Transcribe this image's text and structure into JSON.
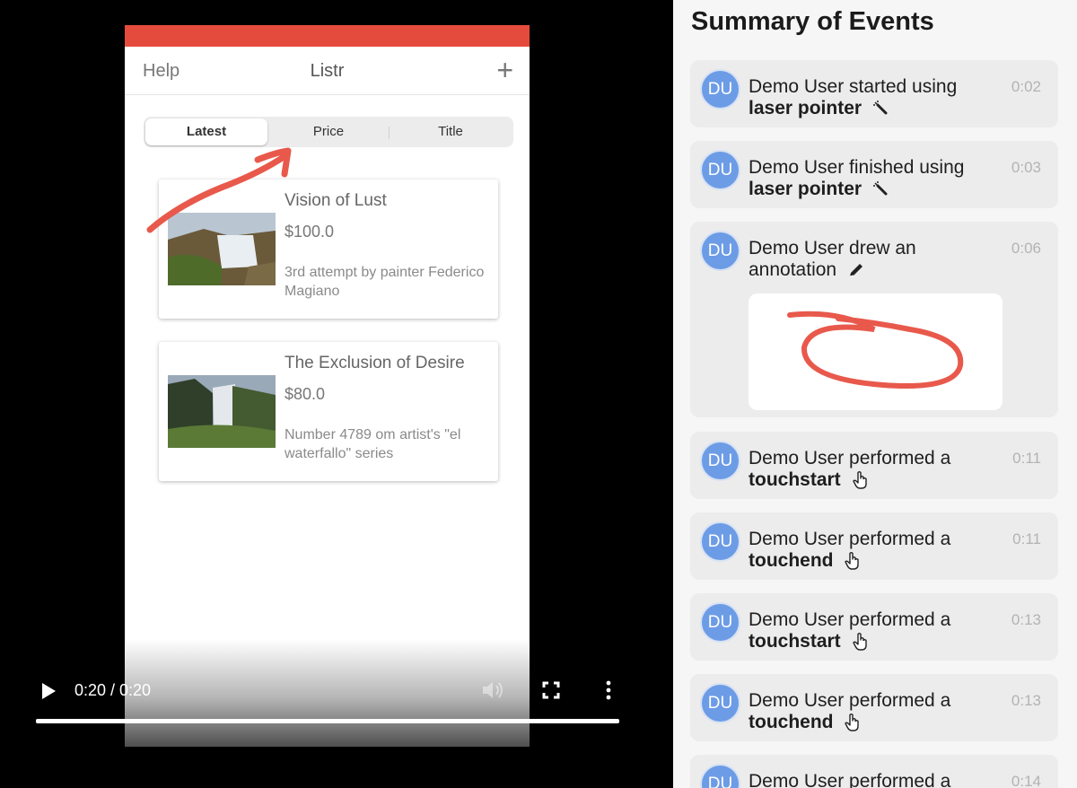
{
  "app": {
    "nav": {
      "left": "Help",
      "title": "Listr",
      "add": "+"
    },
    "tabs": [
      {
        "label": "Latest",
        "active": true
      },
      {
        "label": "Price",
        "active": false
      },
      {
        "label": "Title",
        "active": false
      }
    ],
    "listings": [
      {
        "title": "Vision of Lust",
        "price": "$100.0",
        "description": "3rd attempt by painter Federico Magiano"
      },
      {
        "title": "The Exclusion of Desire",
        "price": "$80.0",
        "description": "Number 4789 om artist's \"el waterfallo\" series"
      }
    ],
    "status_color": "#e54b3c",
    "annotation_color": "#e8594c"
  },
  "player": {
    "time": "0:20 / 0:20",
    "progress": 1.0
  },
  "summary": {
    "title": "Summary of Events",
    "events": [
      {
        "avatar": "DU",
        "text": "Demo User started using",
        "bold": "laser pointer",
        "icon": "laser-pointer-icon",
        "time": "0:02"
      },
      {
        "avatar": "DU",
        "text": "Demo User finished using",
        "bold": "laser pointer",
        "icon": "laser-pointer-icon",
        "time": "0:03"
      },
      {
        "avatar": "DU",
        "text": "Demo User drew an annotation",
        "bold": "",
        "icon": "pencil-icon",
        "time": "0:06"
      },
      {
        "avatar": "DU",
        "text": "Demo User performed a",
        "bold": "touchstart",
        "icon": "hand-pointer-icon",
        "time": "0:11"
      },
      {
        "avatar": "DU",
        "text": "Demo User performed a",
        "bold": "touchend",
        "icon": "hand-pointer-icon",
        "time": "0:11"
      },
      {
        "avatar": "DU",
        "text": "Demo User performed a",
        "bold": "touchstart",
        "icon": "hand-pointer-icon",
        "time": "0:13"
      },
      {
        "avatar": "DU",
        "text": "Demo User performed a",
        "bold": "touchend",
        "icon": "hand-pointer-icon",
        "time": "0:13"
      },
      {
        "avatar": "DU",
        "text": "Demo User performed a",
        "bold": "",
        "icon": "",
        "time": "0:14"
      }
    ]
  }
}
